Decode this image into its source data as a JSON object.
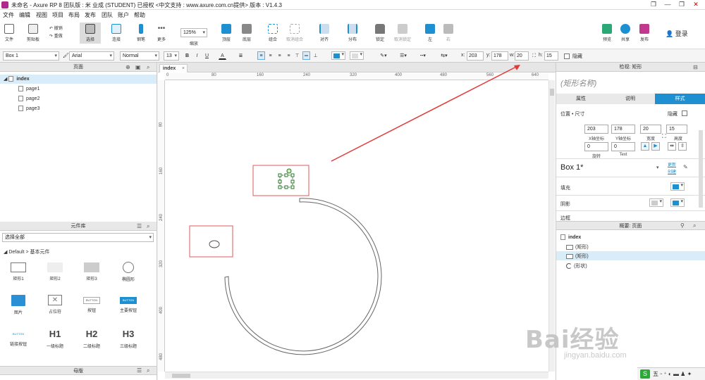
{
  "window": {
    "title": "未命名 - Axure RP 8 团队版 : 米 业成 (STUDENT) 已授权  <中文支持 : www.axure.com.cn提供> 版本 : V1.4.3",
    "min": "—",
    "max": "❐",
    "close": "✕",
    "ctx": "❐"
  },
  "menu": [
    "文件",
    "编辑",
    "视图",
    "项目",
    "布局",
    "发布",
    "团队",
    "账户",
    "帮助"
  ],
  "toolbar": {
    "file": "文件",
    "clipboard": "剪贴板",
    "undo": "撤销",
    "redo": "重做",
    "select": "选择",
    "connect": "连接",
    "pen": "钢笔",
    "more": "更多",
    "zoom_value": "125%",
    "zoom_label": "缩放",
    "top": "顶层",
    "bottom": "底层",
    "group": "组合",
    "ungroup": "取消组合",
    "align": "对齐",
    "distribute": "分布",
    "lock": "锁定",
    "unlock": "取消锁定",
    "left": "左",
    "right": "右",
    "preview": "预览",
    "share": "共享",
    "publish": "发布",
    "login": "登录"
  },
  "format": {
    "widget_name": "Box 1",
    "font": "Arial",
    "weight": "Normal",
    "size": "13",
    "bold": "B",
    "italic": "I",
    "underline": "U",
    "text_color": "A",
    "x_label": "x:",
    "x": "203",
    "y_label": "y:",
    "y": "178",
    "w_label": "w:",
    "w": "20",
    "h_label": "h:",
    "h": "15",
    "hidden": "隐藏"
  },
  "pages_panel": {
    "title": "页面",
    "root": "index",
    "children": [
      "page1",
      "page2",
      "page3"
    ]
  },
  "library": {
    "title": "元件库",
    "filter": "选择全部",
    "group": "Default > 基本元件",
    "items": [
      "矩形1",
      "矩形2",
      "矩形3",
      "椭圆形",
      "图片",
      "占位符",
      "按钮",
      "主要按钮",
      "链接按钮",
      "一级标题",
      "二级标题",
      "三级标题"
    ],
    "button_text": "BUTTON",
    "h1": "H1",
    "h2": "H2",
    "h3": "H3",
    "masters": "母版"
  },
  "canvas": {
    "tab": "index",
    "ruler_x": [
      "0",
      "80",
      "160",
      "240",
      "320",
      "400",
      "480",
      "560",
      "640"
    ],
    "ruler_y": [
      "80",
      "160",
      "240",
      "320",
      "400",
      "480"
    ]
  },
  "inspector": {
    "title": "检视: 矩形",
    "name_placeholder": "(矩形名称)",
    "tabs": [
      "属性",
      "说明",
      "样式"
    ],
    "pos_size": "位置 • 尺寸",
    "hidden": "隐藏",
    "x": "203",
    "y": "178",
    "w": "20",
    "h": "15",
    "x_cap": "X轴坐标",
    "y_cap": "Y轴坐标",
    "w_cap": "宽度",
    "h_cap": "高度",
    "rot": "0",
    "text_rot": "0",
    "rot_cap": "旋转",
    "text_cap": "Text",
    "style_name": "Box 1*",
    "update": "更新",
    "create": "创建",
    "fill": "填充",
    "shadow": "阴影",
    "border": "边框"
  },
  "outline": {
    "title": "概要: 页面",
    "root": "index",
    "items": [
      "(矩形)",
      "(矩形)",
      "(形状)"
    ]
  },
  "colors": {
    "accent": "#1e90d2",
    "selection_red": "#e25a5a",
    "arrow_red": "#e23a3a"
  },
  "watermark": {
    "main": "Bai经验",
    "sub": "jingyan.baidu.com"
  }
}
